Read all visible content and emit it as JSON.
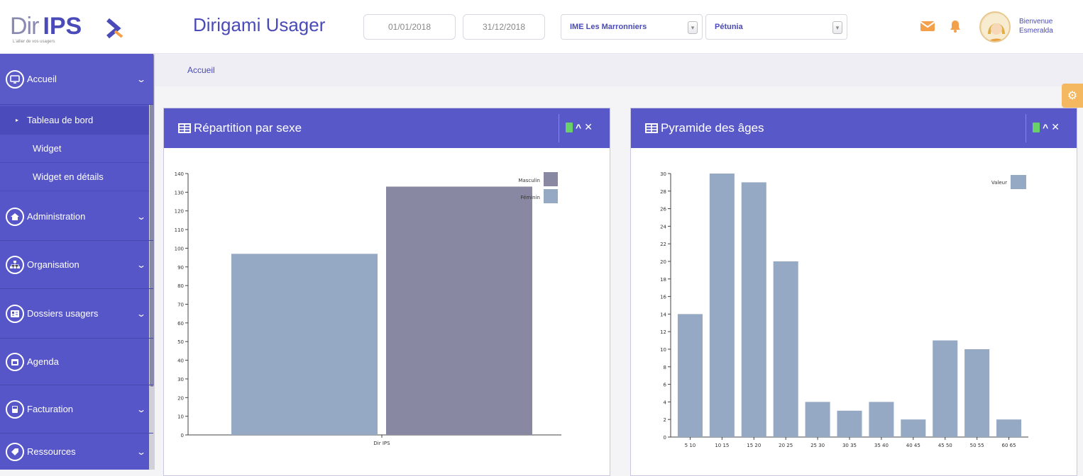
{
  "header": {
    "logo_dir": "Dir",
    "logo_ips": "IPS",
    "logo_tagline": "L'allier de vos usagers",
    "app_title": "Dirigami Usager",
    "date_start": "01/01/2018",
    "date_end": "31/12/2018",
    "establishment": "IME Les Marronniers",
    "unit": "Pétunia",
    "welcome_line1": "Bienvenue",
    "welcome_line2": "Esmeralda",
    "colors": {
      "accent": "#5858c8",
      "mail": "#f4a04a",
      "bell": "#f4a04a"
    }
  },
  "sidebar": {
    "sections": [
      {
        "label": "Accueil",
        "icon": "monitor-icon"
      },
      {
        "label": "Administration",
        "icon": "home-icon"
      },
      {
        "label": "Organisation",
        "icon": "sitemap-icon"
      },
      {
        "label": "Dossiers usagers",
        "icon": "id-card-icon"
      },
      {
        "label": "Agenda",
        "icon": "calendar-icon"
      },
      {
        "label": "Facturation",
        "icon": "calculator-icon"
      },
      {
        "label": "Ressources",
        "icon": "tag-icon"
      }
    ],
    "sub_items": [
      {
        "label": "Tableau de bord",
        "active": true
      },
      {
        "label": "Widget"
      },
      {
        "label": "Widget en détails"
      }
    ]
  },
  "breadcrumb": {
    "current": "Accueil"
  },
  "panels": [
    {
      "title": "Répartition par sexe"
    },
    {
      "title": "Pyramide des âges"
    }
  ],
  "chart_data": [
    {
      "type": "bar",
      "categories": [
        "Dir IPS"
      ],
      "series": [
        {
          "name": "Féminin",
          "values": [
            97
          ],
          "color": "#95a8c4"
        },
        {
          "name": "Masculin",
          "values": [
            133
          ],
          "color": "#8888a2"
        }
      ],
      "ylim": [
        0,
        140
      ],
      "yticks": [
        0,
        10,
        20,
        30,
        40,
        50,
        60,
        70,
        80,
        90,
        100,
        110,
        120,
        130,
        140
      ],
      "legend": [
        "Masculin",
        "Féminin"
      ],
      "legend_placement": "top-right"
    },
    {
      "type": "bar",
      "categories": [
        "5 10",
        "10 15",
        "15 20",
        "20 25",
        "25 30",
        "30 35",
        "35 40",
        "40 45",
        "45 50",
        "50 55",
        "60 65"
      ],
      "series": [
        {
          "name": "Valeur",
          "values": [
            14,
            30,
            29,
            20,
            4,
            3,
            4,
            2,
            11,
            10,
            2
          ],
          "color": "#95a8c4"
        }
      ],
      "ylim": [
        0,
        30
      ],
      "yticks": [
        0,
        2,
        4,
        6,
        8,
        10,
        12,
        14,
        16,
        18,
        20,
        22,
        24,
        26,
        28,
        30
      ],
      "legend": [
        "Valeur"
      ],
      "legend_placement": "top-right"
    }
  ]
}
